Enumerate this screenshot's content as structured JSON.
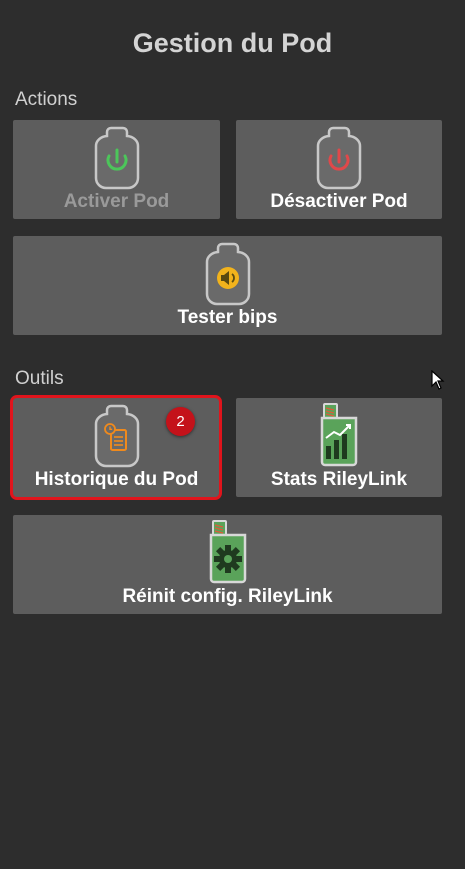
{
  "header": {
    "title": "Gestion du Pod"
  },
  "sections": {
    "actions_label": "Actions",
    "tools_label": "Outils"
  },
  "actions": {
    "activate_label": "Activer Pod",
    "deactivate_label": "Désactiver Pod",
    "test_beeps_label": "Tester bips"
  },
  "tools": {
    "pod_history_label": "Historique du Pod",
    "rileylink_stats_label": "Stats RileyLink",
    "reset_rileylink_label": "Réinit config. RileyLink"
  },
  "annotation": {
    "badge_number": "2"
  },
  "colors": {
    "background": "#2d2d2d",
    "tile": "#5d5d5d",
    "power_on": "#4cc65a",
    "power_off": "#e0484a",
    "speaker": "#f2b31c",
    "history": "#f08a1c",
    "rileylink_green": "#5aa35a",
    "highlight": "#e0141c"
  },
  "icons": {
    "activate": "pod-power-on-icon",
    "deactivate": "pod-power-off-icon",
    "test_beeps": "pod-speaker-icon",
    "pod_history": "pod-history-icon",
    "rileylink_stats": "rileylink-stats-icon",
    "reset_rileylink": "rileylink-gear-icon"
  }
}
